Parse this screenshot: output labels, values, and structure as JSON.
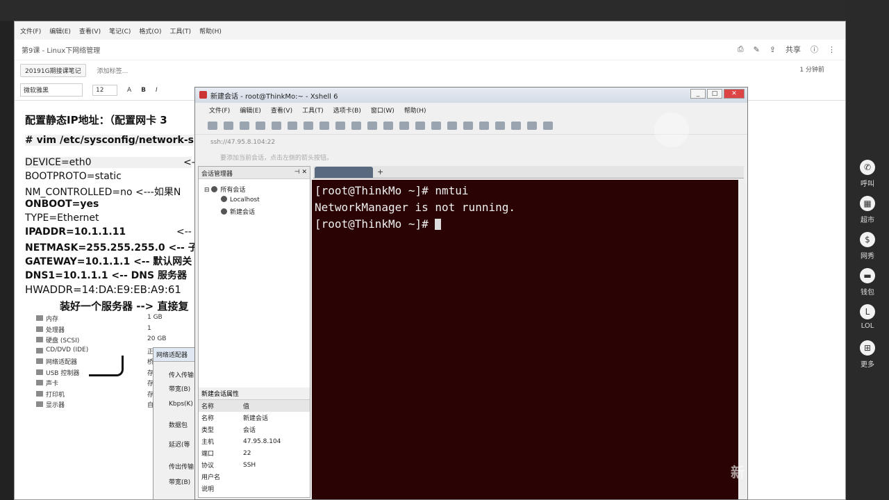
{
  "note_app": {
    "menu": [
      "文件(F)",
      "编辑(E)",
      "查看(V)",
      "笔记(C)",
      "格式(O)",
      "工具(T)",
      "帮助(H)"
    ],
    "tab_title": "第9课 - Linux下网络管理",
    "notebook": "20191G期接课笔记",
    "add_tag": "添加标签...",
    "share": "共享",
    "read_time": "1 分钟前",
    "font": "微软雅黑",
    "font_size": "12",
    "bold": "B",
    "italic": "I"
  },
  "document": {
    "heading": "配置静态IP地址：（配置网卡 3",
    "vim": "# vim /etc/sysconfig/network-s",
    "device": "DEVICE=eth0",
    "device_note": "<--",
    "bootproto": "BOOTPROTO=static",
    "nm_controlled": "NM_CONTROLLED=no <---如果N",
    "onboot": "ONBOOT=yes",
    "type": "TYPE=Ethernet",
    "ipaddr": "IPADDR=10.1.1.11",
    "ipaddr_note": "<--",
    "netmask": "NETMASK=255.255.255.0 <-- 子",
    "gateway": "GATEWAY=10.1.1.1 <-- 默认网关",
    "dns": "DNS1=10.1.1.1 <-- DNS 服务器",
    "hwaddr": "HWADDR=14:DA:E9:EB:A9:61",
    "footer": "装好一个服务器 --> 直接复"
  },
  "hardware": [
    {
      "name": "内存",
      "value": "1 GB"
    },
    {
      "name": "处理器",
      "value": "1"
    },
    {
      "name": "硬盘 (SCSI)",
      "value": "20 GB"
    },
    {
      "name": "CD/DVD (IDE)",
      "value": "正"
    },
    {
      "name": "网络适配器",
      "value": "桥"
    },
    {
      "name": "USB 控制器",
      "value": "存"
    },
    {
      "name": "声卡",
      "value": "存"
    },
    {
      "name": "打印机",
      "value": "存"
    },
    {
      "name": "显示器",
      "value": "自"
    }
  ],
  "adapter_dialog": {
    "title": "网络适配器",
    "items": [
      "传入传输",
      "带宽(B)",
      "Kbps(K)",
      "数据包",
      "延迟(等",
      "传出传输",
      "带宽(B)"
    ]
  },
  "xshell": {
    "title": "新建会话 - root@ThinkMo:~ - Xshell 6",
    "menu": [
      "文件(F)",
      "编辑(E)",
      "查看(V)",
      "工具(T)",
      "选项卡(B)",
      "窗口(W)",
      "帮助(H)"
    ],
    "address": "ssh://47.95.8.104:22",
    "hint": "要添加当前会话，点击左侧的箭头按钮。",
    "session_manager": "会话管理器",
    "tree_root": "所有会话",
    "sessions": [
      "Localhost",
      "新建会话"
    ],
    "props_title": "新建会话属性",
    "props_header": {
      "k": "名称",
      "v": "值"
    },
    "props": [
      {
        "k": "名称",
        "v": "新建会话"
      },
      {
        "k": "类型",
        "v": "会话"
      },
      {
        "k": "主机",
        "v": "47.95.8.104"
      },
      {
        "k": "端口",
        "v": "22"
      },
      {
        "k": "协议",
        "v": "SSH"
      },
      {
        "k": "用户名",
        "v": ""
      },
      {
        "k": "说明",
        "v": ""
      }
    ],
    "terminal_lines": [
      "[root@ThinkMo ~]# nmtui",
      "NetworkManager is not running.",
      "[root@ThinkMo ~]# "
    ]
  },
  "right_strip": [
    {
      "icon": "phone-icon",
      "glyph": "✆",
      "label": "呼叫"
    },
    {
      "icon": "market-icon",
      "glyph": "▦",
      "label": "超市"
    },
    {
      "icon": "dollar-icon",
      "glyph": "$",
      "label": "网秀"
    },
    {
      "icon": "wallet-icon",
      "glyph": "▬",
      "label": "钱包"
    },
    {
      "icon": "lol-icon",
      "glyph": "L",
      "label": "LOL"
    },
    {
      "icon": "more-icon",
      "glyph": "⊞",
      "label": "更多"
    }
  ],
  "watermark": "新 bili"
}
